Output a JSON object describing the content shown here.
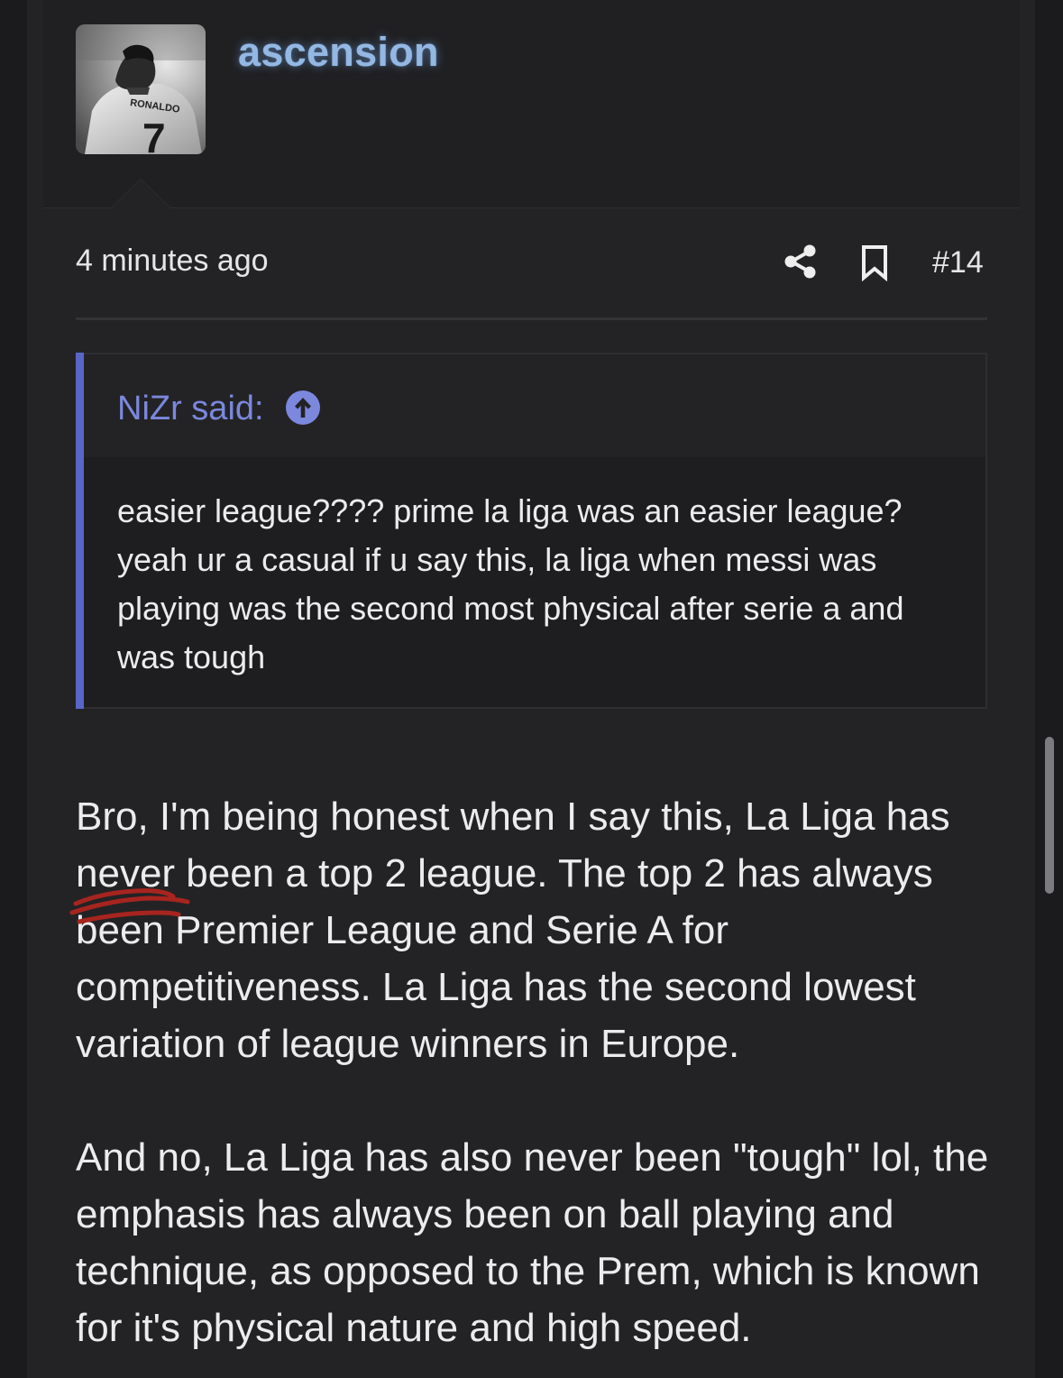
{
  "user": {
    "name": "ascension",
    "avatar_icon": "avatar-photo-icon",
    "avatar_jersey_text": "RONALDO",
    "avatar_jersey_number": "7"
  },
  "meta": {
    "time": "4 minutes ago",
    "share_icon": "share-icon",
    "bookmark_icon": "bookmark-icon",
    "post_number": "#14"
  },
  "quote": {
    "author": "NiZr said:",
    "up_icon": "arrow-up-circle-icon",
    "text": "easier league???? prime la liga was an easier league? yeah ur a casual if u say this, la liga when messi was playing was the second most physical after serie a and was tough"
  },
  "post": {
    "paragraph1": "Bro, I'm being honest when I say this, La Liga has never been a top 2 league. The top 2 has always been Premier League and Serie A for competitiveness. La Liga has the second lowest variation of league winners in Europe.",
    "paragraph2": "And no, La Liga has also never been \"tough\" lol, the emphasis has always been on ball playing and technique, as opposed to the Prem, which is known for it's physical nature and high speed."
  },
  "colors": {
    "background": "#1b1b1d",
    "post_background": "#232325",
    "username": "#93b8e3",
    "quote_accent": "#5966c8",
    "quote_author": "#7b88de",
    "text": "#ececee",
    "scribble": "#a8241f"
  }
}
